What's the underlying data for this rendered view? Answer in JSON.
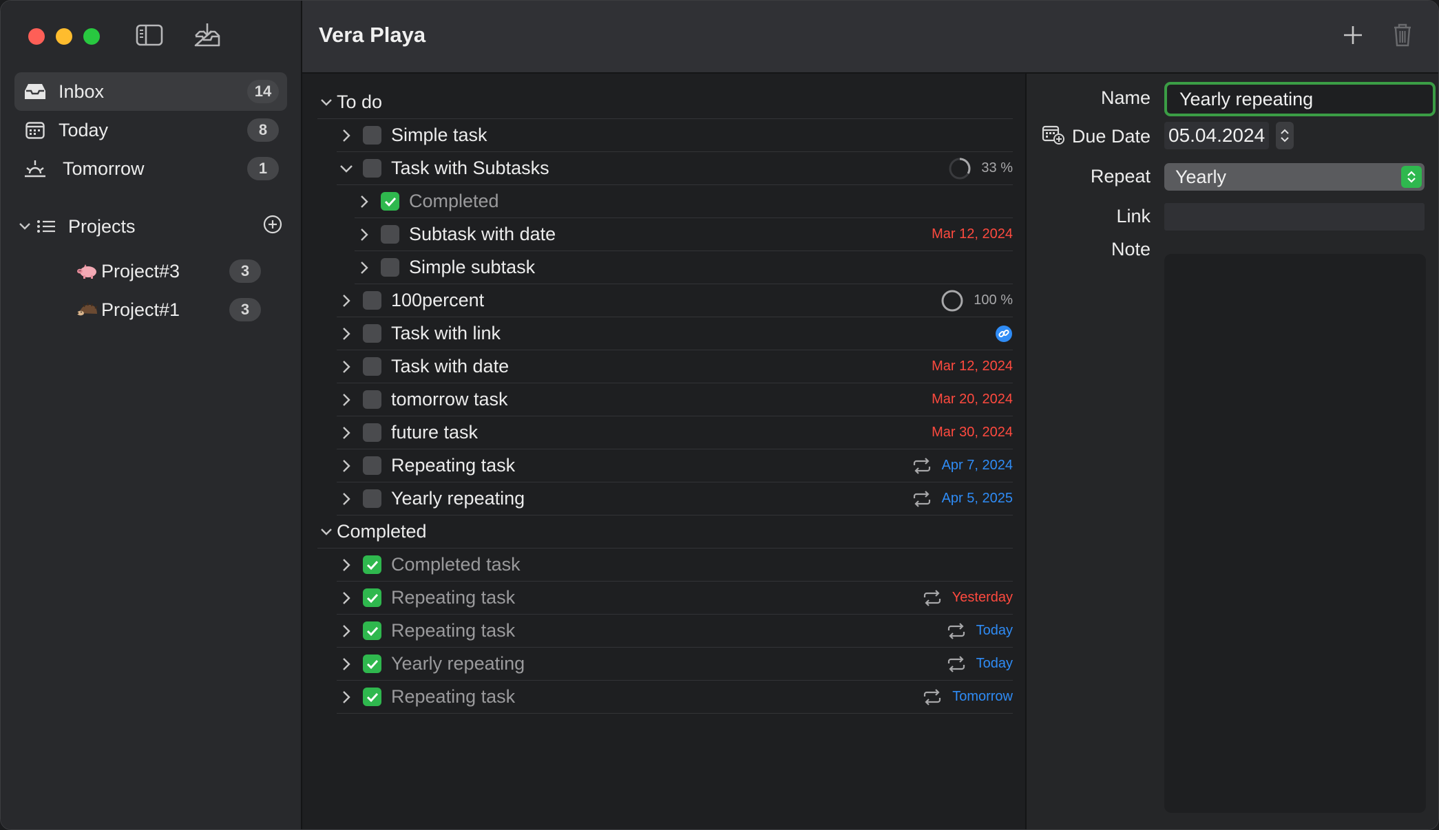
{
  "header": {
    "title": "Vera Playa"
  },
  "sidebar": {
    "items": [
      {
        "label": "Inbox",
        "count": "14",
        "icon": "inbox-icon"
      },
      {
        "label": "Today",
        "count": "8",
        "icon": "calendar-icon"
      },
      {
        "label": "Tomorrow",
        "count": "1",
        "icon": "sunrise-icon"
      }
    ],
    "projects_label": "Projects",
    "projects": [
      {
        "label": "Project#3",
        "count": "3",
        "icon": "pig-icon"
      },
      {
        "label": "Project#1",
        "count": "3",
        "icon": "hedgehog-icon"
      }
    ]
  },
  "groups": {
    "todo": "To do",
    "completed": "Completed"
  },
  "todo_tasks": [
    {
      "label": "Simple task"
    },
    {
      "label": "Task with Subtasks",
      "progress_text": "33 %",
      "progress": 0.33
    },
    {
      "label": "Completed"
    },
    {
      "label": "Subtask with date",
      "date": "Mar 12, 2024"
    },
    {
      "label": "Simple subtask"
    },
    {
      "label": "100percent",
      "progress_text": "100 %",
      "progress": 1.0
    },
    {
      "label": "Task with link",
      "icon": "link-icon"
    },
    {
      "label": "Task with date",
      "date": "Mar 12, 2024"
    },
    {
      "label": "tomorrow task",
      "date": "Mar 20, 2024"
    },
    {
      "label": "future task",
      "date": "Mar 30, 2024"
    },
    {
      "label": "Repeating task",
      "date": "Apr 7, 2024"
    },
    {
      "label": "Yearly repeating",
      "date": "Apr 5, 2025"
    }
  ],
  "completed_tasks": [
    {
      "label": "Completed task"
    },
    {
      "label": "Repeating task",
      "date": "Yesterday"
    },
    {
      "label": "Repeating task",
      "date": "Today"
    },
    {
      "label": "Yearly repeating",
      "date": "Today"
    },
    {
      "label": "Repeating task",
      "date": "Tomorrow"
    }
  ],
  "detail": {
    "name_label": "Name",
    "name_value": "Yearly repeating",
    "due_label": "Due Date",
    "due_value": "05.04.2024",
    "repeat_label": "Repeat",
    "repeat_value": "Yearly",
    "link_label": "Link",
    "note_label": "Note"
  },
  "colors": {
    "accent_green": "#2fb84e",
    "date_overdue": "#ff4a3f",
    "date_future": "#2f8cf6"
  }
}
